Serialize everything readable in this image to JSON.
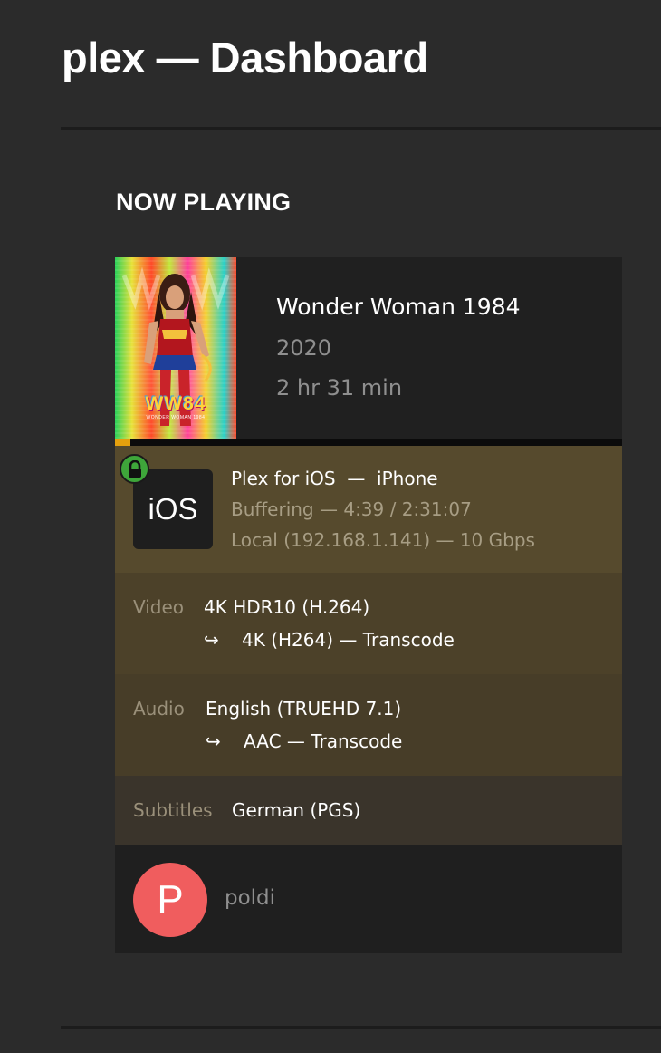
{
  "app": {
    "title": "plex — Dashboard"
  },
  "section": {
    "title": "NOW PLAYING"
  },
  "session": {
    "media": {
      "title": "Wonder Woman 1984",
      "year": "2020",
      "duration": "2 hr 31 min",
      "poster_title": "WW84",
      "poster_subtitle": "WONDER WOMAN 1984"
    },
    "progress": {
      "fraction": 0.031,
      "fill_color": "#e5a00d"
    },
    "player": {
      "secure_icon": "lock-icon",
      "platform": "iOS",
      "line1": "Plex for iOS  —  iPhone",
      "state_line": "Buffering — 4:39 / 2:31:07",
      "network_line": "Local (192.168.1.141) — 10 Gbps"
    },
    "streams": {
      "video": {
        "label": "Video",
        "source": "4K HDR10 (H.264)",
        "arrow": "↪",
        "target": "4K (H264) — Transcode"
      },
      "audio": {
        "label": "Audio",
        "source": "English (TRUEHD 7.1)",
        "arrow": "↪",
        "target": "AAC — Transcode"
      },
      "subtitles": {
        "label": "Subtitles",
        "source": "German (PGS)"
      }
    },
    "user": {
      "avatar_letter": "P",
      "avatar_color": "#f05d5e",
      "name": "poldi"
    }
  },
  "colors": {
    "background": "#2b2b2b",
    "player_bg": "#564a2d",
    "accent": "#e5a00d",
    "lock_green": "#3ea63a"
  }
}
